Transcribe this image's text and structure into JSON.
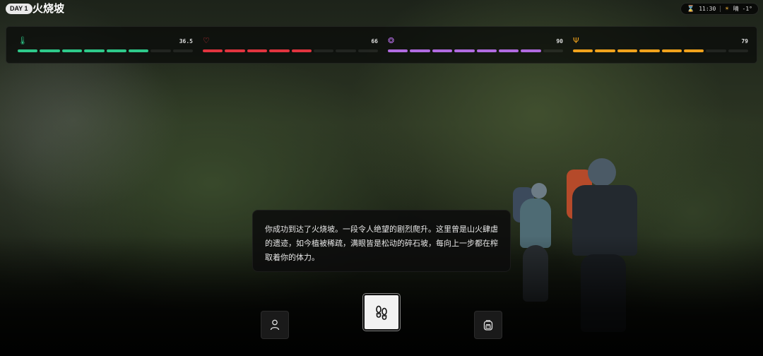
{
  "header": {
    "day_badge": "DAY 1",
    "location": "火烧坡",
    "time": "11:30",
    "weather": "晴 -1°"
  },
  "stats": [
    {
      "icon": "thermometer-icon",
      "glyph": "🌡",
      "value_text": "36.5",
      "level": 0.75,
      "color": "#2ec98a"
    },
    {
      "icon": "heart-icon",
      "glyph": "♡",
      "value_text": "66",
      "level": 0.66,
      "color": "#e0343f"
    },
    {
      "icon": "brain-icon",
      "glyph": "❂",
      "value_text": "90",
      "level": 0.875,
      "color": "#b06be0"
    },
    {
      "icon": "fork-knife-icon",
      "glyph": "Ψ",
      "value_text": "79",
      "level": 0.75,
      "color": "#f0a21c"
    }
  ],
  "narrative": {
    "text": "你成功到达了火烧坡。一段令人绝望的剧烈爬升。这里曾是山火肆虐的遗迹，如今植被稀疏，满眼皆是松动的碎石坡，每向上一步都在榨取着你的体力。"
  },
  "actions": {
    "left_icon": "person-icon",
    "center_icon": "footprints-icon",
    "right_icon": "backpack-icon"
  }
}
